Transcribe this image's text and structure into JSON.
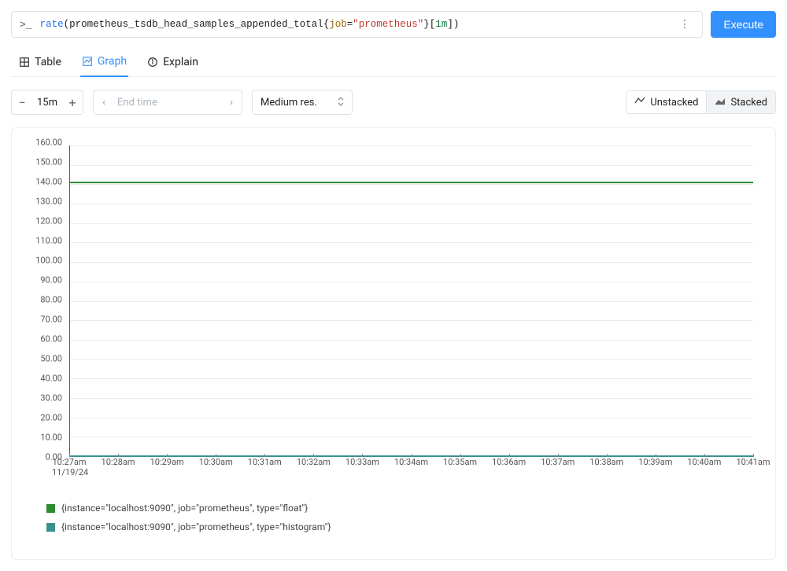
{
  "query": {
    "fn": "rate",
    "metric": "prometheus_tsdb_head_samples_appended_total",
    "label_key": "job",
    "label_op": "=",
    "label_val": "\"prometheus\"",
    "range_lb": "[",
    "range_dur": "1m",
    "range_rb": "]",
    "close": ")"
  },
  "execute_label": "Execute",
  "tabs": {
    "table": "Table",
    "graph": "Graph",
    "explain": "Explain"
  },
  "controls": {
    "range": "15m",
    "end_time_placeholder": "End time",
    "resolution": "Medium res."
  },
  "stack": {
    "unstacked": "Unstacked",
    "stacked": "Stacked"
  },
  "legend": {
    "s1": "{instance=\"localhost:9090\", job=\"prometheus\", type=\"float\"}",
    "s2": "{instance=\"localhost:9090\", job=\"prometheus\", type=\"histogram\"}"
  },
  "colors": {
    "series1": "#2e8b2e",
    "series2": "#3a8f8f"
  },
  "chart_data": {
    "type": "line",
    "title": "",
    "xlabel": "",
    "ylabel": "",
    "ylim": [
      0,
      160
    ],
    "y_ticks": [
      0,
      10,
      20,
      30,
      40,
      50,
      60,
      70,
      80,
      90,
      100,
      110,
      120,
      130,
      140,
      150,
      160
    ],
    "x_categories": [
      "10:27am",
      "10:28am",
      "10:29am",
      "10:30am",
      "10:31am",
      "10:32am",
      "10:33am",
      "10:34am",
      "10:35am",
      "10:36am",
      "10:37am",
      "10:38am",
      "10:39am",
      "10:40am",
      "10:41am"
    ],
    "x_date": "11/19/24",
    "series": [
      {
        "name": "{instance=\"localhost:9090\", job=\"prometheus\", type=\"float\"}",
        "color": "#2e8b2e",
        "values": [
          141,
          141,
          141,
          141,
          141,
          141,
          141,
          141,
          141,
          141,
          141,
          141,
          141,
          141,
          141
        ]
      },
      {
        "name": "{instance=\"localhost:9090\", job=\"prometheus\", type=\"histogram\"}",
        "color": "#3a8f8f",
        "values": [
          0,
          0,
          0,
          0,
          0,
          0,
          0,
          0,
          0,
          0,
          0,
          0,
          0,
          0,
          0
        ]
      }
    ]
  }
}
